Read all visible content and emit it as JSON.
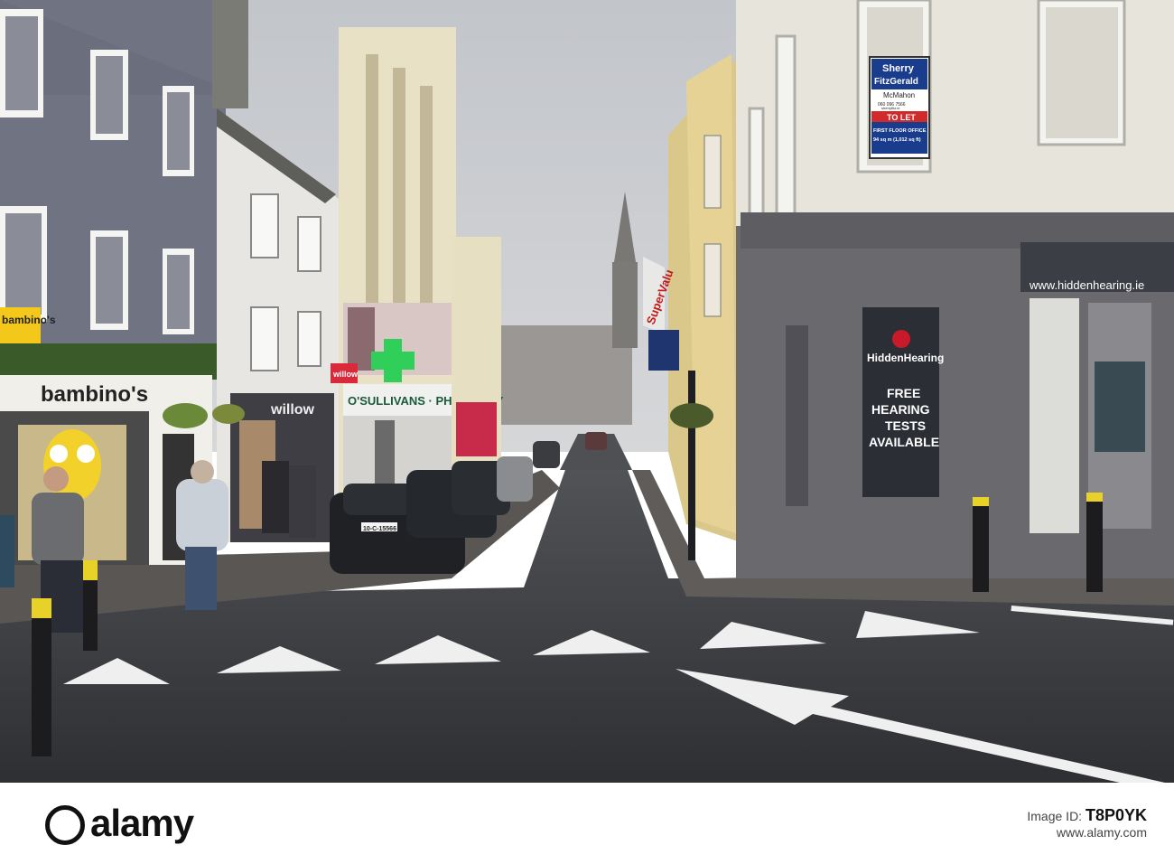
{
  "photo": {
    "subject": "wet town street with shops and church spire",
    "signs": {
      "agent_brand_line1": "Sherry",
      "agent_brand_line2": "FitzGerald",
      "agent_branch": "McMahon",
      "agent_phone": "060 096 7566",
      "agent_web": "sherryfitz.ie",
      "agent_to_let": "TO LET",
      "agent_desc_line1": "FIRST FLOOR OFFICE",
      "agent_desc_line2": "94 sq m (1,012 sq ft)",
      "bambinos_top": "bambino's",
      "bambinos_main": "bambino's",
      "pharmacy": "O'SULLIVANS · PHARMACY",
      "willow_small": "willow",
      "willow_main": "willow",
      "supervalu": "SuperValu",
      "hidden_url": "www.hiddenhearing.ie",
      "hidden_brand": "HiddenHearing",
      "hidden_line1": "FREE",
      "hidden_line2": "HEARING",
      "hidden_line3": "TESTS",
      "hidden_line4": "AVAILABLE",
      "car_plate": "10-C-15566"
    },
    "colors": {
      "sky": "#c9cbcf",
      "road": "#3a3c40",
      "grey_building": "#6f7382",
      "pharmacy_cross": "#2fcf5a",
      "agent_blue": "#1a3c8c",
      "agent_red": "#d12a2a",
      "hidden_grey": "#6a6a6e"
    }
  },
  "watermark": {
    "logo": "alamy",
    "image_id_label": "Image ID:",
    "image_id": "T8P0YK",
    "site": "www.alamy.com"
  }
}
